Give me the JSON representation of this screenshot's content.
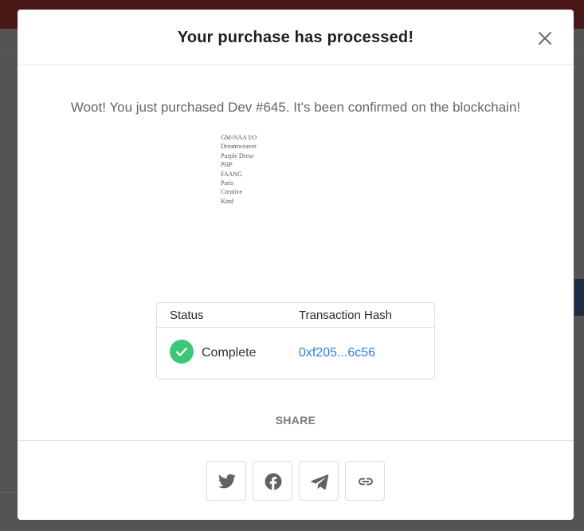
{
  "modal": {
    "title": "Your purchase has processed!",
    "message": "Woot! You just purchased Dev #645. It's been confirmed on the blockchain!"
  },
  "nft": {
    "lines": [
      "GM-NAA I/O",
      "Dreamweaver",
      "Purple Dress",
      "PHP",
      "FAANG",
      "Paris",
      "Creative",
      "Kind"
    ]
  },
  "transaction": {
    "status_header": "Status",
    "hash_header": "Transaction Hash",
    "status_value": "Complete",
    "hash_value": "0xf205...6c56"
  },
  "share": {
    "label": "SHARE",
    "buttons": [
      {
        "icon": "twitter-icon"
      },
      {
        "icon": "facebook-icon"
      },
      {
        "icon": "telegram-icon"
      },
      {
        "icon": "link-icon"
      }
    ]
  },
  "colors": {
    "success": "#3cc779",
    "link": "#2f7fd4",
    "icon": "#5f6368"
  }
}
